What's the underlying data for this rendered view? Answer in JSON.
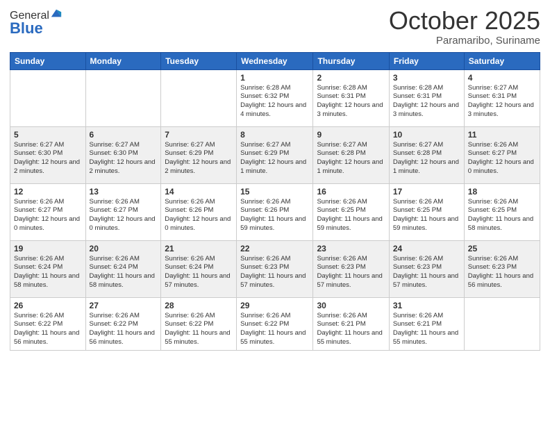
{
  "logo": {
    "general": "General",
    "blue": "Blue"
  },
  "header": {
    "month": "October 2025",
    "location": "Paramaribo, Suriname"
  },
  "weekdays": [
    "Sunday",
    "Monday",
    "Tuesday",
    "Wednesday",
    "Thursday",
    "Friday",
    "Saturday"
  ],
  "weeks": [
    [
      {
        "day": "",
        "sunrise": "",
        "sunset": "",
        "daylight": ""
      },
      {
        "day": "",
        "sunrise": "",
        "sunset": "",
        "daylight": ""
      },
      {
        "day": "",
        "sunrise": "",
        "sunset": "",
        "daylight": ""
      },
      {
        "day": "1",
        "sunrise": "Sunrise: 6:28 AM",
        "sunset": "Sunset: 6:32 PM",
        "daylight": "Daylight: 12 hours and 4 minutes."
      },
      {
        "day": "2",
        "sunrise": "Sunrise: 6:28 AM",
        "sunset": "Sunset: 6:31 PM",
        "daylight": "Daylight: 12 hours and 3 minutes."
      },
      {
        "day": "3",
        "sunrise": "Sunrise: 6:28 AM",
        "sunset": "Sunset: 6:31 PM",
        "daylight": "Daylight: 12 hours and 3 minutes."
      },
      {
        "day": "4",
        "sunrise": "Sunrise: 6:27 AM",
        "sunset": "Sunset: 6:31 PM",
        "daylight": "Daylight: 12 hours and 3 minutes."
      }
    ],
    [
      {
        "day": "5",
        "sunrise": "Sunrise: 6:27 AM",
        "sunset": "Sunset: 6:30 PM",
        "daylight": "Daylight: 12 hours and 2 minutes."
      },
      {
        "day": "6",
        "sunrise": "Sunrise: 6:27 AM",
        "sunset": "Sunset: 6:30 PM",
        "daylight": "Daylight: 12 hours and 2 minutes."
      },
      {
        "day": "7",
        "sunrise": "Sunrise: 6:27 AM",
        "sunset": "Sunset: 6:29 PM",
        "daylight": "Daylight: 12 hours and 2 minutes."
      },
      {
        "day": "8",
        "sunrise": "Sunrise: 6:27 AM",
        "sunset": "Sunset: 6:29 PM",
        "daylight": "Daylight: 12 hours and 1 minute."
      },
      {
        "day": "9",
        "sunrise": "Sunrise: 6:27 AM",
        "sunset": "Sunset: 6:28 PM",
        "daylight": "Daylight: 12 hours and 1 minute."
      },
      {
        "day": "10",
        "sunrise": "Sunrise: 6:27 AM",
        "sunset": "Sunset: 6:28 PM",
        "daylight": "Daylight: 12 hours and 1 minute."
      },
      {
        "day": "11",
        "sunrise": "Sunrise: 6:26 AM",
        "sunset": "Sunset: 6:27 PM",
        "daylight": "Daylight: 12 hours and 0 minutes."
      }
    ],
    [
      {
        "day": "12",
        "sunrise": "Sunrise: 6:26 AM",
        "sunset": "Sunset: 6:27 PM",
        "daylight": "Daylight: 12 hours and 0 minutes."
      },
      {
        "day": "13",
        "sunrise": "Sunrise: 6:26 AM",
        "sunset": "Sunset: 6:27 PM",
        "daylight": "Daylight: 12 hours and 0 minutes."
      },
      {
        "day": "14",
        "sunrise": "Sunrise: 6:26 AM",
        "sunset": "Sunset: 6:26 PM",
        "daylight": "Daylight: 12 hours and 0 minutes."
      },
      {
        "day": "15",
        "sunrise": "Sunrise: 6:26 AM",
        "sunset": "Sunset: 6:26 PM",
        "daylight": "Daylight: 11 hours and 59 minutes."
      },
      {
        "day": "16",
        "sunrise": "Sunrise: 6:26 AM",
        "sunset": "Sunset: 6:25 PM",
        "daylight": "Daylight: 11 hours and 59 minutes."
      },
      {
        "day": "17",
        "sunrise": "Sunrise: 6:26 AM",
        "sunset": "Sunset: 6:25 PM",
        "daylight": "Daylight: 11 hours and 59 minutes."
      },
      {
        "day": "18",
        "sunrise": "Sunrise: 6:26 AM",
        "sunset": "Sunset: 6:25 PM",
        "daylight": "Daylight: 11 hours and 58 minutes."
      }
    ],
    [
      {
        "day": "19",
        "sunrise": "Sunrise: 6:26 AM",
        "sunset": "Sunset: 6:24 PM",
        "daylight": "Daylight: 11 hours and 58 minutes."
      },
      {
        "day": "20",
        "sunrise": "Sunrise: 6:26 AM",
        "sunset": "Sunset: 6:24 PM",
        "daylight": "Daylight: 11 hours and 58 minutes."
      },
      {
        "day": "21",
        "sunrise": "Sunrise: 6:26 AM",
        "sunset": "Sunset: 6:24 PM",
        "daylight": "Daylight: 11 hours and 57 minutes."
      },
      {
        "day": "22",
        "sunrise": "Sunrise: 6:26 AM",
        "sunset": "Sunset: 6:23 PM",
        "daylight": "Daylight: 11 hours and 57 minutes."
      },
      {
        "day": "23",
        "sunrise": "Sunrise: 6:26 AM",
        "sunset": "Sunset: 6:23 PM",
        "daylight": "Daylight: 11 hours and 57 minutes."
      },
      {
        "day": "24",
        "sunrise": "Sunrise: 6:26 AM",
        "sunset": "Sunset: 6:23 PM",
        "daylight": "Daylight: 11 hours and 57 minutes."
      },
      {
        "day": "25",
        "sunrise": "Sunrise: 6:26 AM",
        "sunset": "Sunset: 6:23 PM",
        "daylight": "Daylight: 11 hours and 56 minutes."
      }
    ],
    [
      {
        "day": "26",
        "sunrise": "Sunrise: 6:26 AM",
        "sunset": "Sunset: 6:22 PM",
        "daylight": "Daylight: 11 hours and 56 minutes."
      },
      {
        "day": "27",
        "sunrise": "Sunrise: 6:26 AM",
        "sunset": "Sunset: 6:22 PM",
        "daylight": "Daylight: 11 hours and 56 minutes."
      },
      {
        "day": "28",
        "sunrise": "Sunrise: 6:26 AM",
        "sunset": "Sunset: 6:22 PM",
        "daylight": "Daylight: 11 hours and 55 minutes."
      },
      {
        "day": "29",
        "sunrise": "Sunrise: 6:26 AM",
        "sunset": "Sunset: 6:22 PM",
        "daylight": "Daylight: 11 hours and 55 minutes."
      },
      {
        "day": "30",
        "sunrise": "Sunrise: 6:26 AM",
        "sunset": "Sunset: 6:21 PM",
        "daylight": "Daylight: 11 hours and 55 minutes."
      },
      {
        "day": "31",
        "sunrise": "Sunrise: 6:26 AM",
        "sunset": "Sunset: 6:21 PM",
        "daylight": "Daylight: 11 hours and 55 minutes."
      },
      {
        "day": "",
        "sunrise": "",
        "sunset": "",
        "daylight": ""
      }
    ]
  ]
}
